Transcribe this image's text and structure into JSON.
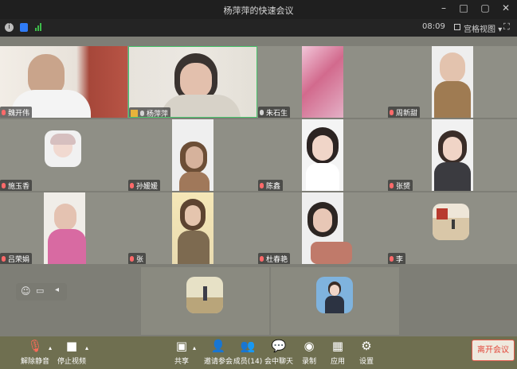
{
  "window": {
    "title": "杨萍萍的快速会议"
  },
  "infobar": {
    "time": "08:09",
    "view_mode": "宫格视图"
  },
  "participants": [
    {
      "name": "魏开伟"
    },
    {
      "name": "杨萍萍"
    },
    {
      "name": "朱石生"
    },
    {
      "name": "周新甜"
    },
    {
      "name": "施玉香"
    },
    {
      "name": "孙媛媛"
    },
    {
      "name": "陈鑫"
    },
    {
      "name": "张赟"
    },
    {
      "name": "吕荣娟"
    },
    {
      "name": "张"
    },
    {
      "name": "杜春艳"
    },
    {
      "name": "李"
    }
  ],
  "toolbar": {
    "unmute": "解除静音",
    "stop_video": "停止视频",
    "share": "共享",
    "invite": "邀请参会",
    "members": "成员(14)",
    "chat": "会中聊天",
    "record": "录制",
    "apps": "应用",
    "settings": "设置",
    "leave": "离开会议"
  }
}
